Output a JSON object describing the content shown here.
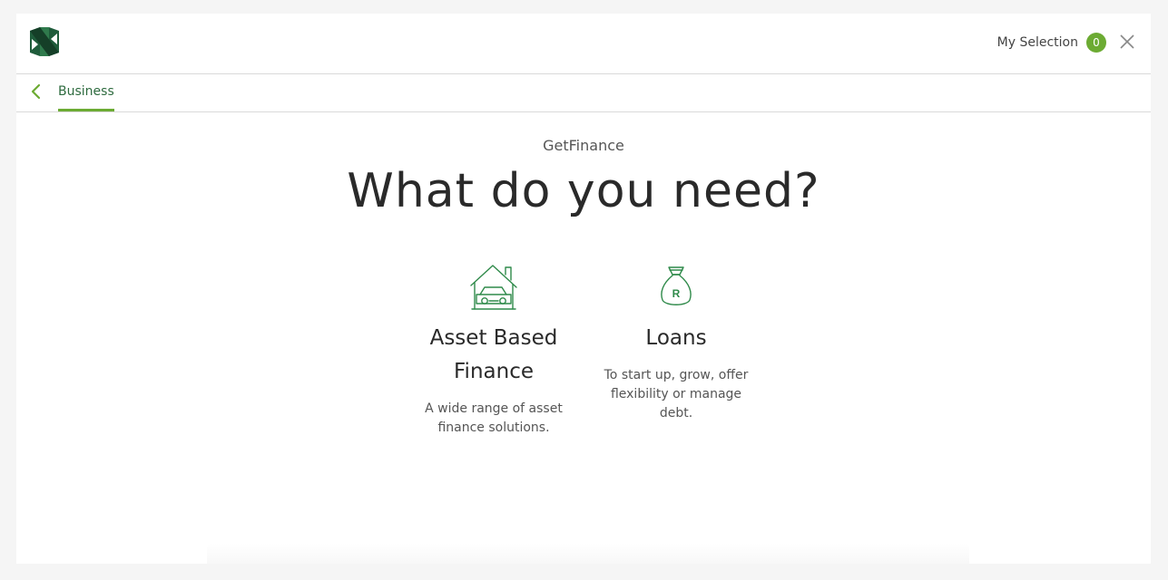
{
  "header": {
    "logo_icon": "nedbank-logo-icon",
    "selection_label": "My Selection",
    "selection_count": "0",
    "close_icon": "close-icon"
  },
  "subnav": {
    "back_icon": "chevron-left-icon",
    "tab_label": "Business"
  },
  "main": {
    "eyebrow": "GetFinance",
    "headline": "What do you need?",
    "cards": [
      {
        "icon": "house-car-icon",
        "title_line1": "Asset Based",
        "title_line2": "Finance",
        "description": "A wide range of asset finance solutions."
      },
      {
        "icon": "money-bag-icon",
        "title": "Loans",
        "description": "To start up, grow, offer flexibility or manage debt."
      }
    ]
  },
  "colors": {
    "accent": "#6cab33",
    "brand_dark": "#1f5c3b",
    "icon_green": "#2f8a4a"
  }
}
